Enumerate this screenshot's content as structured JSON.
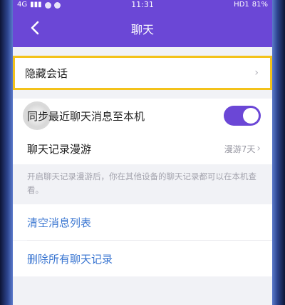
{
  "status_bar": {
    "network": "4G",
    "time": "11:31",
    "hd": "HD1",
    "battery": "81%"
  },
  "header": {
    "back_icon": "chevron-left-icon",
    "title": "聊天"
  },
  "rows": {
    "hidden_chat": {
      "label": "隐藏会话",
      "chevron": "›"
    },
    "sync_recent": {
      "label": "同步最近聊天消息至本机",
      "toggle_on": true
    },
    "roaming": {
      "label": "聊天记录漫游",
      "value": "漫游7天",
      "chevron": "›"
    }
  },
  "hint": "开启聊天记录漫游后，你在其他设备的聊天记录都可以在本机查看。",
  "actions": {
    "clear_list": "清空消息列表",
    "delete_all": "删除所有聊天记录"
  },
  "colors": {
    "brand_purple": "#6b47d6",
    "highlight_yellow": "#f3c21a",
    "link_blue": "#3a76d1"
  }
}
